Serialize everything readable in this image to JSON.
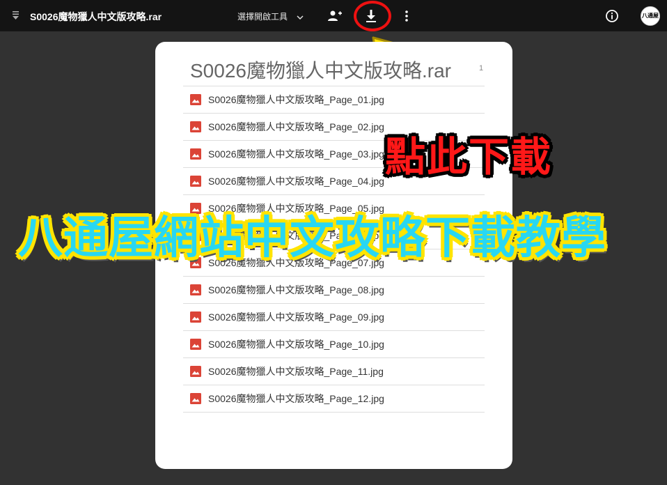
{
  "topbar": {
    "file_title": "S0026魔物獵人中文版攻略.rar",
    "open_with_label": "選擇開啟工具",
    "avatar_text": "八通屋"
  },
  "archive": {
    "name": "S0026魔物獵人中文版攻略.rar",
    "size_partial": "1",
    "files": [
      "S0026魔物獵人中文版攻略_Page_01.jpg",
      "S0026魔物獵人中文版攻略_Page_02.jpg",
      "S0026魔物獵人中文版攻略_Page_03.jpg",
      "S0026魔物獵人中文版攻略_Page_04.jpg",
      "S0026魔物獵人中文版攻略_Page_05.jpg",
      "S0026魔物獵人中文版攻略_Page_06.jpg",
      "S0026魔物獵人中文版攻略_Page_07.jpg",
      "S0026魔物獵人中文版攻略_Page_08.jpg",
      "S0026魔物獵人中文版攻略_Page_09.jpg",
      "S0026魔物獵人中文版攻略_Page_10.jpg",
      "S0026魔物獵人中文版攻略_Page_11.jpg",
      "S0026魔物獵人中文版攻略_Page_12.jpg"
    ]
  },
  "overlay": {
    "download_here": "點此下載",
    "tutorial_title": "八通屋網站中文攻略下載教學"
  },
  "colors": {
    "topbar_bg": "#141414",
    "page_bg": "#323232",
    "image_icon_red": "#db4437",
    "highlight_red": "#ee1111",
    "arrow_yellow": "#ffe400",
    "title_cyan": "#28d7f2"
  },
  "icons": {
    "menu": "menu-icon",
    "chevron": "chevron-down-icon",
    "add_person": "add-person-icon",
    "download": "download-icon",
    "more": "more-vert-icon",
    "info": "info-icon",
    "file_type": "image-file-icon"
  }
}
